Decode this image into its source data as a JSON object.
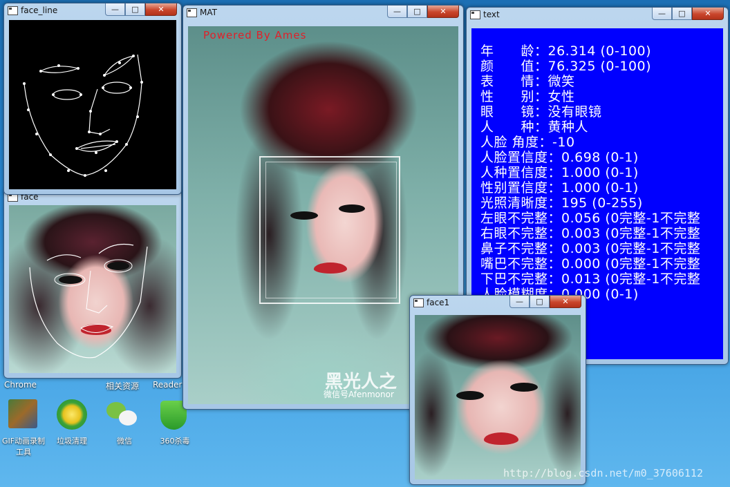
{
  "windows": {
    "face_line": {
      "title": "face_line"
    },
    "face": {
      "title": "face"
    },
    "mat": {
      "title": "MAT",
      "overlay_text": "Powered By Ames",
      "watermark_logo": "黑光人之",
      "watermark_text": "微信号Afenmonor"
    },
    "text": {
      "title": "text"
    },
    "face1": {
      "title": "face1"
    }
  },
  "window_controls": {
    "minimize": "—",
    "maximize": "□",
    "close": "✕"
  },
  "text_panel": {
    "background": "#0000ff",
    "lines": [
      "年　　龄：26.314 (0-100)",
      "颜　　值：76.325 (0-100)",
      "表　　情：微笑",
      "性　　别：女性",
      "眼　　镜：没有眼镜",
      "人　　种：黄种人",
      "人脸 角度：-10",
      "人脸置信度：0.698 (0-1)",
      "人种置信度：1.000 (0-1)",
      "性别置信度：1.000 (0-1)",
      "光照清晰度：195 (0-255)",
      "左眼不完整：0.056 (0完整-1不完整",
      "右眼不完整：0.003 (0完整-1不完整",
      "鼻子不完整：0.003 (0完整-1不完整",
      "嘴巴不完整：0.000 (0完整-1不完整",
      "下巴不完整：0.013 (0完整-1不完整",
      "人脸模糊度：0.000 (0-1)"
    ]
  },
  "desktop": {
    "labels_top": [
      "Chrome",
      "相关资源",
      "Reader"
    ],
    "icons": [
      {
        "label": "GIF动画录制\n工具",
        "icon": "gif-recorder-icon"
      },
      {
        "label": "垃圾清理",
        "icon": "cleaner-icon"
      },
      {
        "label": "微信",
        "icon": "wechat-icon"
      },
      {
        "label": "360杀毒",
        "icon": "antivirus-icon"
      }
    ],
    "watermark": "http://blog.csdn.net/m0_37606112"
  },
  "colors": {
    "text_bg": "#0000ff",
    "overlay_red": "#e0202a",
    "close_red": "#c9462c"
  }
}
